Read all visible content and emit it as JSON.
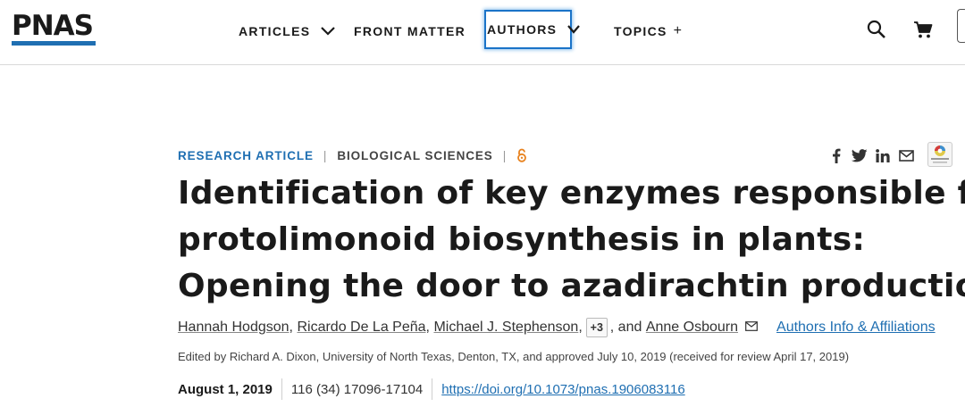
{
  "header": {
    "logo": "PNAS",
    "nav": {
      "articles": "ARTICLES",
      "front_matter": "FRONT MATTER",
      "authors": "AUTHORS",
      "topics": "TOPICS",
      "topics_expand": "+"
    },
    "icons": [
      "search-icon",
      "cart-icon",
      "chevron-down-icon"
    ]
  },
  "article": {
    "type": "RESEARCH ARTICLE",
    "separator": "|",
    "subject": "BIOLOGICAL SCIENCES",
    "open_access_icon": "open-access-icon",
    "share_icons": [
      "facebook-icon",
      "twitter-icon",
      "linkedin-icon",
      "email-icon"
    ],
    "crossmark_label": "Check for updates",
    "title_lines": [
      "Identification of key enzymes responsible for",
      "protolimonoid biosynthesis in plants:",
      "Opening the door to azadirachtin production"
    ],
    "authors": {
      "names": [
        "Hannah Hodgson",
        "Ricardo De La Peña",
        "Michael J. Stephenson"
      ],
      "comma": ",",
      "more": "+3",
      "and": ", and",
      "last": "Anne Osbourn",
      "info_link": "Authors Info & Affiliations"
    },
    "edited_by": "Edited by Richard A. Dixon, University of North Texas, Denton, TX, and approved July 10, 2019 (received for review April 17, 2019)",
    "pub_date": "August 1, 2019",
    "citation": "116 (34) 17096-17104",
    "doi": "https://doi.org/10.1073/pnas.1906083116"
  },
  "colors": {
    "accent": "#1f6fb2",
    "open_access": "#e8821e",
    "focus": "#1a73c8"
  }
}
